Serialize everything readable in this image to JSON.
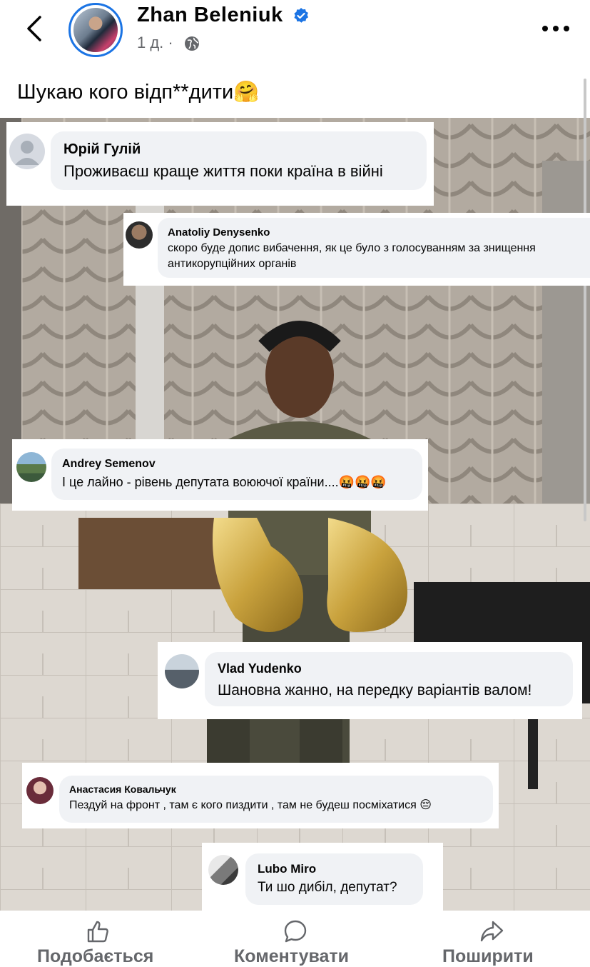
{
  "post": {
    "author": "Zhan  Beleniuk",
    "time": "1 д. ·",
    "text": "Шукаю кого відп**дити🤗"
  },
  "comments": [
    {
      "name": "Юрій Гулій",
      "text": "Проживаєш краще життя поки країна в війні"
    },
    {
      "name": "Anatoliy Denysenko",
      "text": "скоро буде допис вибачення, як це було з голосуванням за знищення антикорупційних органів"
    },
    {
      "name": "Andrey Semenov",
      "text": "І це лайно - рівень депутата воюючої країни....🤬🤬🤬"
    },
    {
      "name": "Vlad Yudenko",
      "text": "Шановна жанно, на передку варіантів валом!"
    },
    {
      "name": "Анастасия Ковальчук",
      "text": "Пездуй на фронт , там є кого пиздити , там не будеш посміхатися 😔"
    },
    {
      "name": "Lubo Miro",
      "text": "Ти шо дибіл, депутат?"
    }
  ],
  "actions": {
    "like": "Подобається",
    "comment": "Коментувати",
    "share": "Поширити"
  },
  "icons": {
    "back": "chevron-left-icon",
    "verified": "verified-badge-icon",
    "privacy": "globe-icon",
    "more": "more-dots-icon",
    "like": "thumbs-up-icon",
    "comment": "comment-bubble-icon",
    "share": "share-arrow-icon"
  },
  "colors": {
    "accent": "#1b74e4",
    "bubble": "#f0f2f5",
    "secondary_text": "#65676b"
  }
}
